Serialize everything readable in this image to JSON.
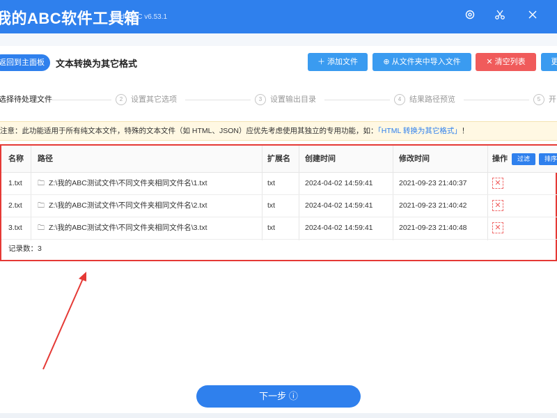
{
  "app": {
    "title": "我的ABC软件工具箱",
    "version": "WodeABC v6.53.1"
  },
  "header": {
    "back_label": "返回到主面板",
    "page_title": "文本转换为其它格式",
    "add_file": "添加文件",
    "import_folder": "从文件夹中导入文件",
    "clear_list": "清空列表",
    "more": "更"
  },
  "steps": [
    {
      "num": "1",
      "label": "选择待处理文件"
    },
    {
      "num": "2",
      "label": "设置其它选项"
    },
    {
      "num": "3",
      "label": "设置输出目录"
    },
    {
      "num": "4",
      "label": "结果路径预览"
    },
    {
      "num": "5",
      "label": "开"
    }
  ],
  "notice": {
    "prefix": "注意：此功能适用于所有纯文本文件，特殊的文本文件（如 HTML、JSON）应优先考虑使用其独立的专用功能，如：",
    "link": "「HTML 转换为其它格式」",
    "suffix": "！"
  },
  "table": {
    "headers": {
      "name": "名称",
      "path": "路径",
      "ext": "扩展名",
      "created": "创建时间",
      "modified": "修改时间",
      "actions": "操作",
      "filter": "过滤",
      "sort": "排序"
    },
    "rows": [
      {
        "name": "1.txt",
        "path": "Z:\\我的ABC测试文件\\不同文件夹相同文件名\\1.txt",
        "ext": "txt",
        "created": "2024-04-02 14:59:41",
        "modified": "2021-09-23 21:40:37"
      },
      {
        "name": "2.txt",
        "path": "Z:\\我的ABC测试文件\\不同文件夹相同文件名\\2.txt",
        "ext": "txt",
        "created": "2024-04-02 14:59:41",
        "modified": "2021-09-23 21:40:42"
      },
      {
        "name": "3.txt",
        "path": "Z:\\我的ABC测试文件\\不同文件夹相同文件名\\3.txt",
        "ext": "txt",
        "created": "2024-04-02 14:59:41",
        "modified": "2021-09-23 21:40:48"
      }
    ],
    "record_count": "记录数：3"
  },
  "footer": {
    "next_label": "下一步"
  },
  "colors": {
    "primary": "#2f80ed",
    "danger": "#f05b5b",
    "highlight": "#e53935"
  }
}
